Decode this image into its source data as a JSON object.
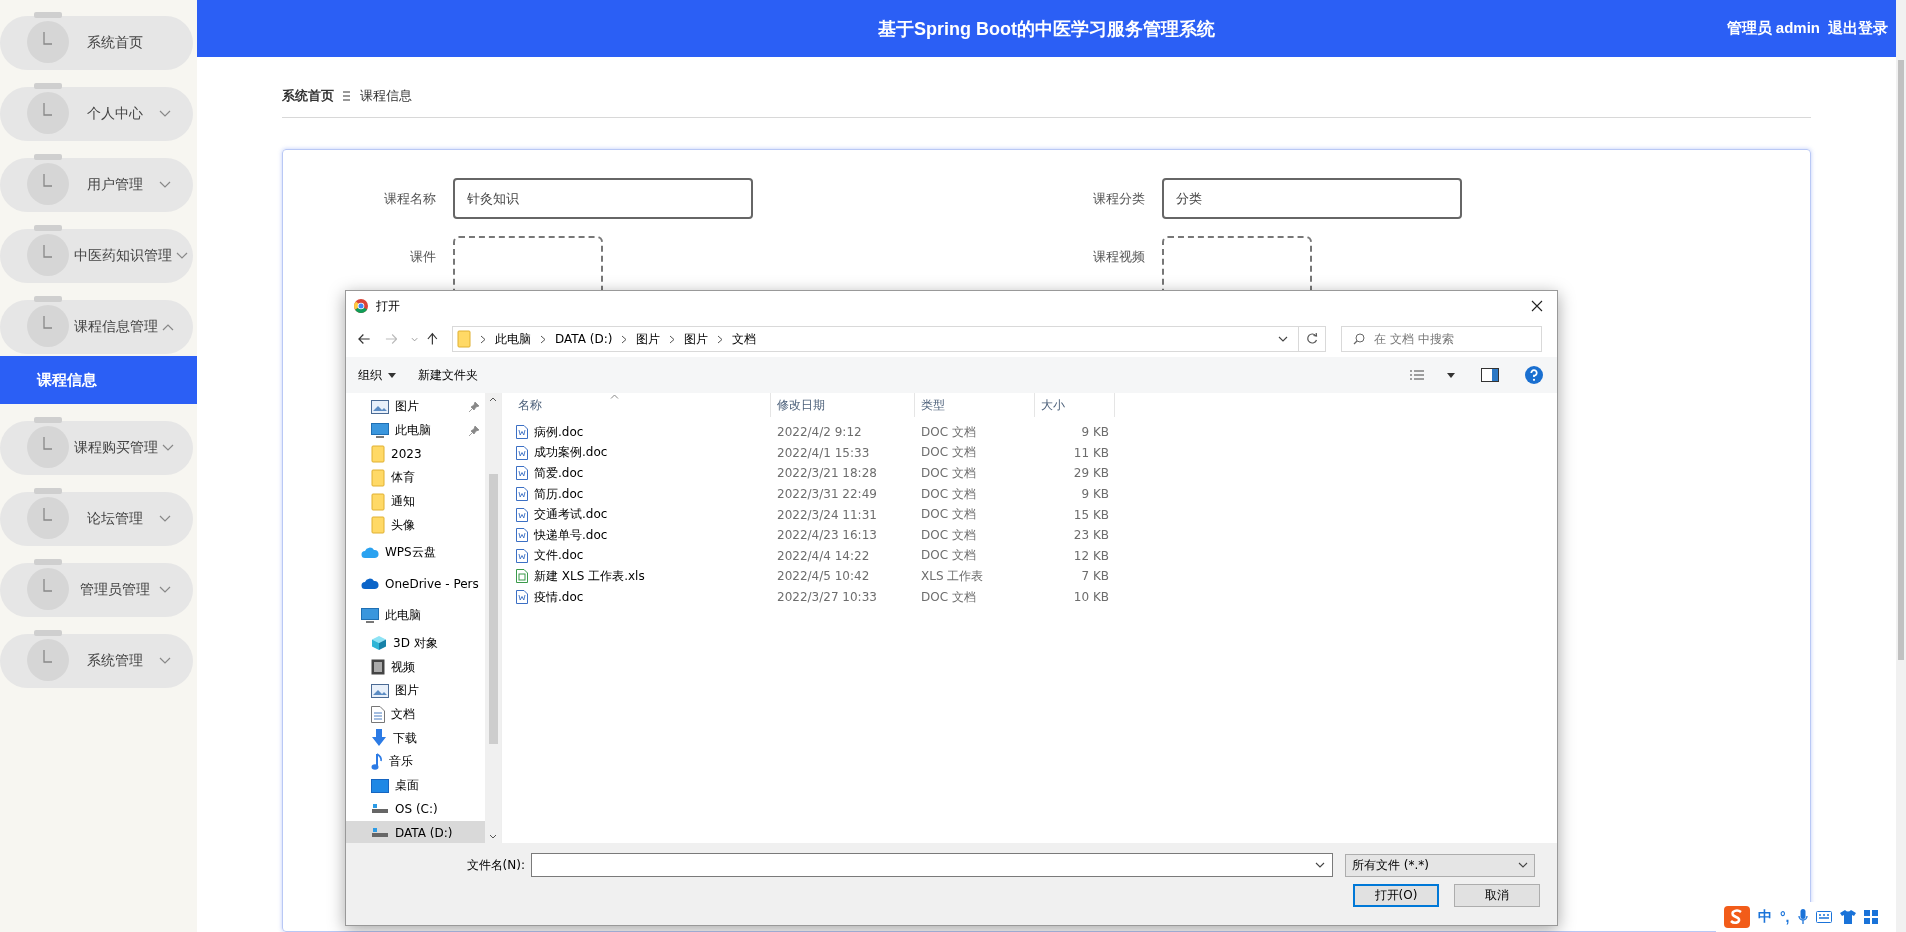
{
  "header": {
    "title": "基于Spring Boot的中医学习服务管理系统",
    "user": "管理员 admin",
    "logout": "退出登录"
  },
  "sidebar": {
    "items": [
      {
        "label": "系统首页",
        "kind": "link"
      },
      {
        "label": "个人中心",
        "kind": "menu",
        "expanded": false
      },
      {
        "label": "用户管理",
        "kind": "menu",
        "expanded": false
      },
      {
        "label": "中医药知识管理",
        "kind": "menu",
        "expanded": false
      },
      {
        "label": "课程信息管理",
        "kind": "menu",
        "expanded": true,
        "children": [
          {
            "label": "课程信息",
            "selected": true
          }
        ]
      },
      {
        "label": "课程购买管理",
        "kind": "menu",
        "expanded": false
      },
      {
        "label": "论坛管理",
        "kind": "menu",
        "expanded": false
      },
      {
        "label": "管理员管理",
        "kind": "menu",
        "expanded": false
      },
      {
        "label": "系统管理",
        "kind": "menu",
        "expanded": false
      }
    ]
  },
  "breadcrumb": [
    {
      "label": "系统首页"
    },
    {
      "label": "课程信息"
    }
  ],
  "form": {
    "fields": [
      {
        "kind": "text",
        "label": "课程名称",
        "value": "针灸知识"
      },
      {
        "kind": "text",
        "label": "课程分类",
        "value": "分类"
      },
      {
        "kind": "upload",
        "label": "课件"
      },
      {
        "kind": "upload",
        "label": "课程视频"
      }
    ]
  },
  "dialog": {
    "title": "打开",
    "path": [
      "此电脑",
      "DATA (D:)",
      "图片",
      "图片",
      "文档"
    ],
    "search": {
      "placeholder": "在 文档 中搜索"
    },
    "toolbar": [
      {
        "label": "组织",
        "dropdown": true
      },
      {
        "label": "新建文件夹",
        "dropdown": false
      }
    ],
    "nav": {
      "quick_access": [
        {
          "label": "图片",
          "kind": "pictures",
          "pinned": true,
          "selected": false
        },
        {
          "label": "此电脑",
          "kind": "pc",
          "pinned": true,
          "selected": false
        },
        {
          "label": "2023",
          "kind": "folder",
          "pinned": false,
          "selected": false
        },
        {
          "label": "体育",
          "kind": "folder",
          "pinned": false,
          "selected": false
        },
        {
          "label": "通知",
          "kind": "folder",
          "pinned": false,
          "selected": false
        },
        {
          "label": "头像",
          "kind": "folder",
          "pinned": false,
          "selected": false
        }
      ],
      "items": [
        {
          "label": "WPS云盘",
          "kind": "cloud",
          "selected": false
        },
        {
          "label": "OneDrive - Pers",
          "kind": "onedrive",
          "selected": false
        },
        {
          "label": "此电脑",
          "kind": "pc",
          "selected": false,
          "children": [
            {
              "label": "3D 对象",
              "kind": "cube",
              "selected": false
            },
            {
              "label": "视频",
              "kind": "video",
              "selected": false
            },
            {
              "label": "图片",
              "kind": "pictures",
              "selected": false
            },
            {
              "label": "文档",
              "kind": "document",
              "selected": false
            },
            {
              "label": "下载",
              "kind": "download",
              "selected": false
            },
            {
              "label": "音乐",
              "kind": "music",
              "selected": false
            },
            {
              "label": "桌面",
              "kind": "desktop",
              "selected": false
            },
            {
              "label": "OS (C:)",
              "kind": "drive",
              "selected": false
            },
            {
              "label": "DATA (D:)",
              "kind": "drive",
              "selected": true
            }
          ]
        }
      ]
    },
    "columns": [
      {
        "label": "名称",
        "sorted": true
      },
      {
        "label": "修改日期",
        "sorted": false
      },
      {
        "label": "类型",
        "sorted": false
      },
      {
        "label": "大小",
        "sorted": false
      }
    ],
    "files": [
      {
        "kind": "doc",
        "name": "病例.doc",
        "date": "2022/4/2 9:12",
        "type": "DOC 文档",
        "size": "9 KB"
      },
      {
        "kind": "doc",
        "name": "成功案例.doc",
        "date": "2022/4/1 15:33",
        "type": "DOC 文档",
        "size": "11 KB"
      },
      {
        "kind": "doc",
        "name": "简爱.doc",
        "date": "2022/3/21 18:28",
        "type": "DOC 文档",
        "size": "29 KB"
      },
      {
        "kind": "doc",
        "name": "简历.doc",
        "date": "2022/3/31 22:49",
        "type": "DOC 文档",
        "size": "9 KB"
      },
      {
        "kind": "doc",
        "name": "交通考试.doc",
        "date": "2022/3/24 11:31",
        "type": "DOC 文档",
        "size": "15 KB"
      },
      {
        "kind": "doc",
        "name": "快递单号.doc",
        "date": "2022/4/23 16:13",
        "type": "DOC 文档",
        "size": "23 KB"
      },
      {
        "kind": "doc",
        "name": "文件.doc",
        "date": "2022/4/4 14:22",
        "type": "DOC 文档",
        "size": "12 KB"
      },
      {
        "kind": "xls",
        "name": "新建 XLS 工作表.xls",
        "date": "2022/4/5 10:42",
        "type": "XLS 工作表",
        "size": "7 KB"
      },
      {
        "kind": "doc",
        "name": "疫情.doc",
        "date": "2022/3/27 10:33",
        "type": "DOC 文档",
        "size": "10 KB"
      }
    ],
    "filename_label": "文件名(N):",
    "filter": "所有文件 (*.*)",
    "buttons": [
      {
        "label": "打开(O)",
        "primary": true
      },
      {
        "label": "取消",
        "primary": false
      }
    ]
  },
  "ime": {
    "labels": [
      "中",
      "°,"
    ]
  }
}
